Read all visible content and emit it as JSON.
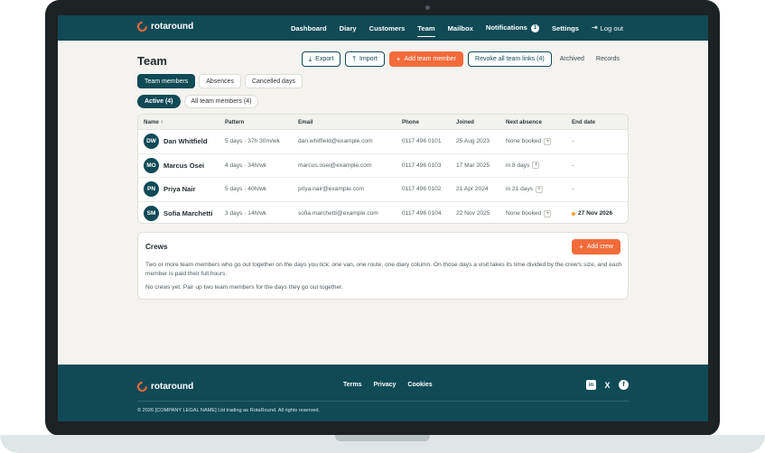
{
  "app": {
    "logo_text": "rotaround"
  },
  "nav": {
    "items": [
      "Dashboard",
      "Diary",
      "Customers",
      "Team",
      "Mailbox"
    ],
    "notifications_label": "Notifications",
    "notifications_count": "1",
    "settings_label": "Settings",
    "logout_label": "Log out",
    "active": "Team"
  },
  "page": {
    "title": "Team",
    "actions": {
      "export": "Export",
      "import": "Import",
      "add_member": "Add team member",
      "revoke": "Revoke all team links (4)",
      "archived": "Archived",
      "records": "Records"
    },
    "tabs": [
      "Team members",
      "Absences",
      "Cancelled days"
    ],
    "filters": [
      "Active (4)",
      "All team members (4)"
    ]
  },
  "table": {
    "headers": {
      "name": "Name ↑",
      "pattern": "Pattern",
      "email": "Email",
      "phone": "Phone",
      "joined": "Joined",
      "next": "Next absence",
      "end": "End date"
    },
    "rows": [
      {
        "initials": "DW",
        "name": "Dan Whitfield",
        "pattern": "5 days · 37h 30m/wk",
        "email": "dan.whitfield@example.com",
        "phone": "0117 496 0101",
        "joined": "25 Aug 2023",
        "next": "None booked",
        "end": "-"
      },
      {
        "initials": "MO",
        "name": "Marcus Osei",
        "pattern": "4 days · 34h/wk",
        "email": "marcus.osei@example.com",
        "phone": "0117 496 0103",
        "joined": "17 Mar 2025",
        "next": "in 8 days",
        "end": "-"
      },
      {
        "initials": "PN",
        "name": "Priya Nair",
        "pattern": "5 days · 40h/wk",
        "email": "priya.nair@example.com",
        "phone": "0117 496 0102",
        "joined": "21 Apr 2024",
        "next": "in 21 days",
        "end": "-"
      },
      {
        "initials": "SM",
        "name": "Sofia Marchetti",
        "pattern": "3 days · 14h/wk",
        "email": "sofia.marchetti@example.com",
        "phone": "0117 496 0104",
        "joined": "22 Nov 2025",
        "next": "None booked",
        "end": "27 Nov 2026"
      }
    ]
  },
  "crews": {
    "title": "Crews",
    "add_label": "Add crew",
    "description": "Two or more team members who go out together on the days you tick: one van, one route, one diary column. On those days a visit takes its time divided by the crew's size, and each member is paid their full hours.",
    "empty": "No crews yet. Pair up two team members for the days they go out together."
  },
  "footer": {
    "logo_text": "rotaround",
    "links": [
      "Terms",
      "Privacy",
      "Cookies"
    ],
    "social": {
      "linkedin": "in",
      "x": "X",
      "facebook": "f"
    },
    "copyright": "© 2026 [COMPANY LEGAL NAME] Ltd trading as RotaRound. All rights reserved."
  },
  "colors": {
    "brand": "#0f4a55",
    "accent": "#f26b3a",
    "background": "#f4f3ef"
  }
}
